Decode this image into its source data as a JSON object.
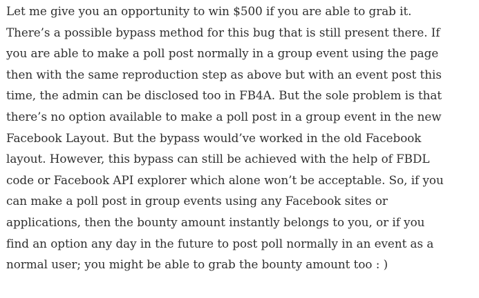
{
  "article": {
    "lines": [
      "Let me give you an opportunity to win $500 if you are able to grab it.",
      "There’s a possible bypass method for this bug that is still present there. If",
      "you are able to make a poll post normally in a group event using the page",
      "then with the same reproduction step as above but with an event post this",
      "time, the admin can be disclosed too in FB4A. But the sole problem is that",
      "there’s no option available to make a poll post in a group event in the new",
      "Facebook Layout. But the bypass would’ve worked in the old Facebook",
      "layout. However, this bypass can still be achieved with the help of FBDL",
      "code or Facebook API explorer which alone won’t be acceptable. So, if you",
      "can make a poll post in group events using any Facebook sites or",
      "applications, then the bounty amount instantly belongs to you, or if you",
      "find an option any day in the future to post poll normally in an event as a",
      "normal user; you might be able to grab the bounty amount too : )"
    ]
  }
}
